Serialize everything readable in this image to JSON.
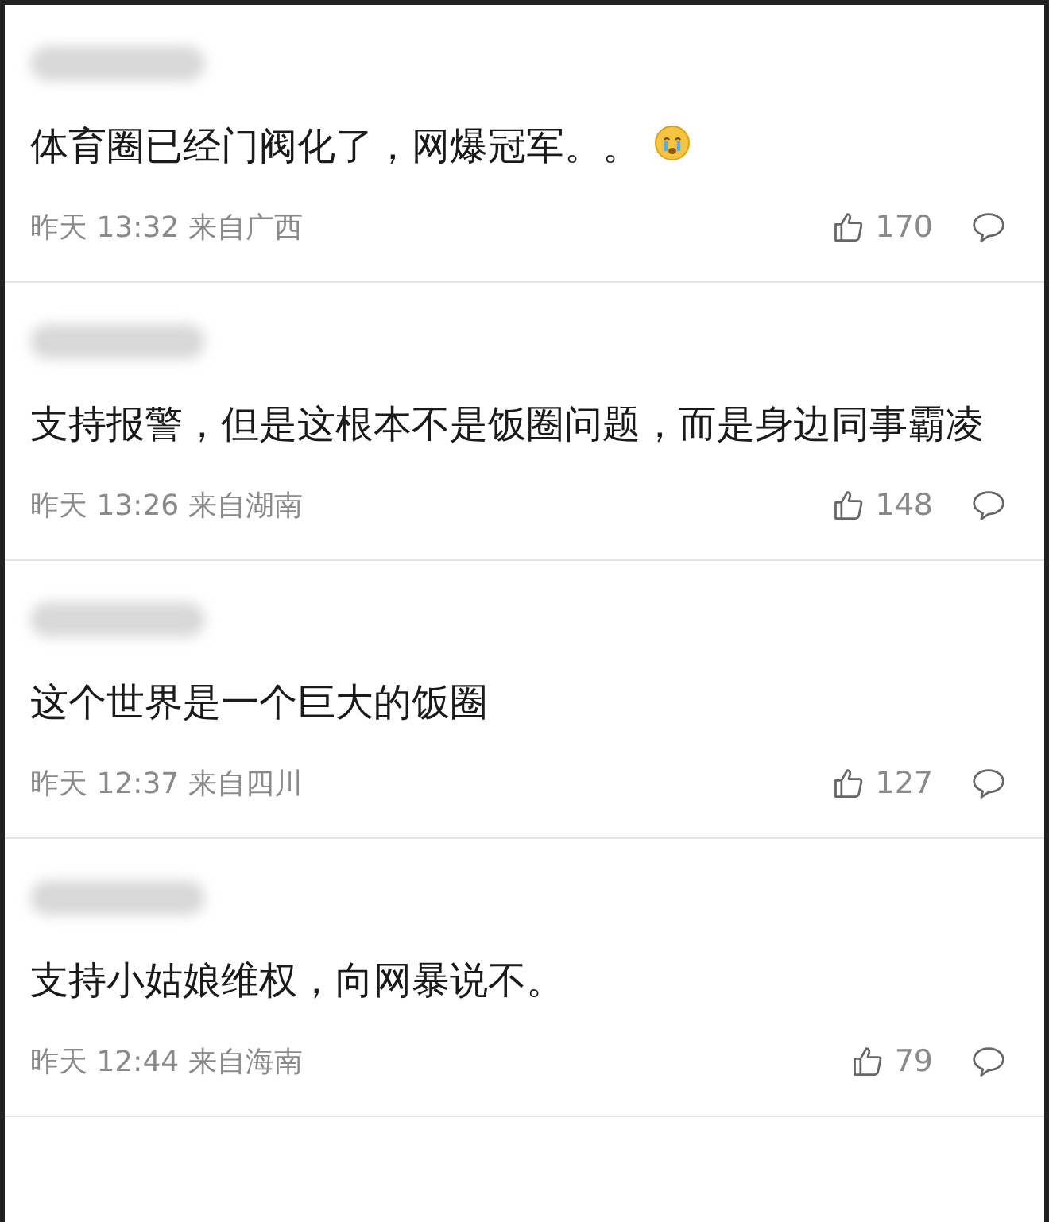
{
  "comments": [
    {
      "text": "体育圈已经门阀化了，网爆冠军。。",
      "emoji": true,
      "time": "昨天 13:32",
      "location": "来自广西",
      "likes": "170"
    },
    {
      "text": "支持报警，但是这根本不是饭圈问题，而是身边同事霸凌",
      "emoji": false,
      "time": "昨天 13:26",
      "location": "来自湖南",
      "likes": "148"
    },
    {
      "text": "这个世界是一个巨大的饭圈",
      "emoji": false,
      "time": "昨天 12:37",
      "location": "来自四川",
      "likes": "127"
    },
    {
      "text": "支持小姑娘维权，向网暴说不。",
      "emoji": false,
      "time": "昨天 12:44",
      "location": "来自海南",
      "likes": "79"
    }
  ]
}
